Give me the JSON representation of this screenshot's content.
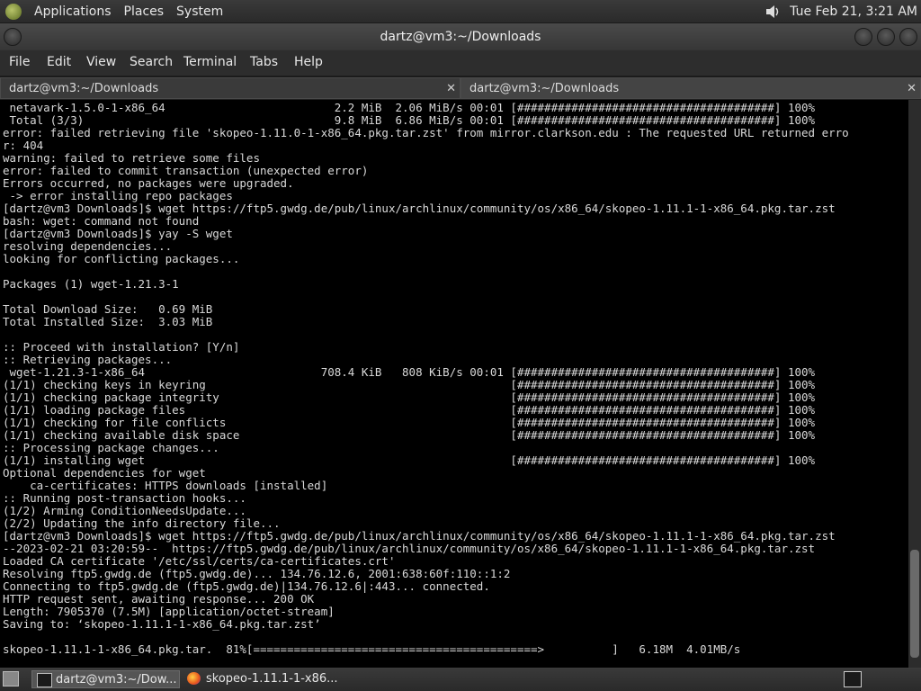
{
  "top_panel": {
    "menus": [
      "Applications",
      "Places",
      "System"
    ],
    "clock": "Tue Feb 21,  3:21 AM"
  },
  "window": {
    "title": "dartz@vm3:~/Downloads"
  },
  "menubar": [
    "File",
    "Edit",
    "View",
    "Search",
    "Terminal",
    "Tabs",
    "Help"
  ],
  "tabs": [
    {
      "label": "dartz@vm3:~/Downloads",
      "close": "✕"
    },
    {
      "label": "dartz@vm3:~/Downloads",
      "close": "✕"
    }
  ],
  "terminal_lines": [
    " netavark-1.5.0-1-x86_64                         2.2 MiB  2.06 MiB/s 00:01 [######################################] 100%",
    " Total (3/3)                                     9.8 MiB  6.86 MiB/s 00:01 [######################################] 100%",
    "error: failed retrieving file 'skopeo-1.11.0-1-x86_64.pkg.tar.zst' from mirror.clarkson.edu : The requested URL returned erro",
    "r: 404",
    "warning: failed to retrieve some files",
    "error: failed to commit transaction (unexpected error)",
    "Errors occurred, no packages were upgraded.",
    " -> error installing repo packages",
    "[dartz@vm3 Downloads]$ wget https://ftp5.gwdg.de/pub/linux/archlinux/community/os/x86_64/skopeo-1.11.1-1-x86_64.pkg.tar.zst",
    "bash: wget: command not found",
    "[dartz@vm3 Downloads]$ yay -S wget",
    "resolving dependencies...",
    "looking for conflicting packages...",
    "",
    "Packages (1) wget-1.21.3-1",
    "",
    "Total Download Size:   0.69 MiB",
    "Total Installed Size:  3.03 MiB",
    "",
    ":: Proceed with installation? [Y/n]",
    ":: Retrieving packages...",
    " wget-1.21.3-1-x86_64                          708.4 KiB   808 KiB/s 00:01 [######################################] 100%",
    "(1/1) checking keys in keyring                                             [######################################] 100%",
    "(1/1) checking package integrity                                           [######################################] 100%",
    "(1/1) loading package files                                                [######################################] 100%",
    "(1/1) checking for file conflicts                                          [######################################] 100%",
    "(1/1) checking available disk space                                        [######################################] 100%",
    ":: Processing package changes...",
    "(1/1) installing wget                                                      [######################################] 100%",
    "Optional dependencies for wget",
    "    ca-certificates: HTTPS downloads [installed]",
    ":: Running post-transaction hooks...",
    "(1/2) Arming ConditionNeedsUpdate...",
    "(2/2) Updating the info directory file...",
    "[dartz@vm3 Downloads]$ wget https://ftp5.gwdg.de/pub/linux/archlinux/community/os/x86_64/skopeo-1.11.1-1-x86_64.pkg.tar.zst",
    "--2023-02-21 03:20:59--  https://ftp5.gwdg.de/pub/linux/archlinux/community/os/x86_64/skopeo-1.11.1-1-x86_64.pkg.tar.zst",
    "Loaded CA certificate '/etc/ssl/certs/ca-certificates.crt'",
    "Resolving ftp5.gwdg.de (ftp5.gwdg.de)... 134.76.12.6, 2001:638:60f:110::1:2",
    "Connecting to ftp5.gwdg.de (ftp5.gwdg.de)|134.76.12.6|:443... connected.",
    "HTTP request sent, awaiting response... 200 OK",
    "Length: 7905370 (7.5M) [application/octet-stream]",
    "Saving to: ‘skopeo-1.11.1-1-x86_64.pkg.tar.zst’",
    "",
    "skopeo-1.11.1-1-x86_64.pkg.tar.  81%[==========================================>          ]   6.18M  4.01MB/s"
  ],
  "taskbar": {
    "tasks": [
      {
        "label": "dartz@vm3:~/Dow...",
        "icon": "terminal-icon"
      },
      {
        "label": "skopeo-1.11.1-1-x86...",
        "icon": "firefox-icon"
      }
    ]
  }
}
